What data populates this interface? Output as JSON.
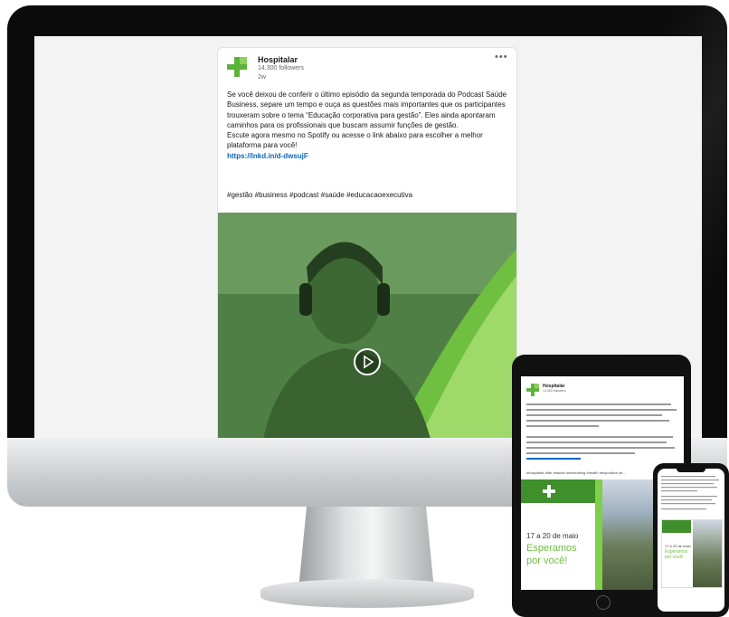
{
  "post": {
    "company": "Hospitalar",
    "followers": "14,300 followers",
    "time": "2w",
    "more": "•••",
    "paragraph1": "Se você deixou de conferir o último episódio da segunda temporada do Podcast Saúde Business, separe um tempo e ouça as questões mais importantes que os participantes trouxeram sobre o tema “Educação corporativa para gestão”. Eles ainda apontaram caminhos para os profissionais que buscam assumir funções de gestão.",
    "paragraph2": "Escute agora mesmo no Spotify ou acesse o link abaixo para escolher a melhor plataforma para você!",
    "link": "https://lnkd.in/d-dwsujF",
    "hashtags": "#gestão #business #podcast #saúde #educacaoexecutiva"
  },
  "tablet": {
    "company": "Hospitalar",
    "followers": "14,300 followers",
    "hashtags": "#hospitalar #fair #saude #networking #health #exposition #e...",
    "promo_date": "17 a 20 de maio",
    "promo_line1": "Esperamos",
    "promo_line2": "por você!"
  },
  "phone": {
    "promo_date": "17 a 20 de maio",
    "promo_line1": "Esperamos",
    "promo_line2": "por você!"
  },
  "colors": {
    "brand_green": "#5bb23b",
    "brand_light_green": "#8cd05a",
    "link_blue": "#0a66c2"
  }
}
